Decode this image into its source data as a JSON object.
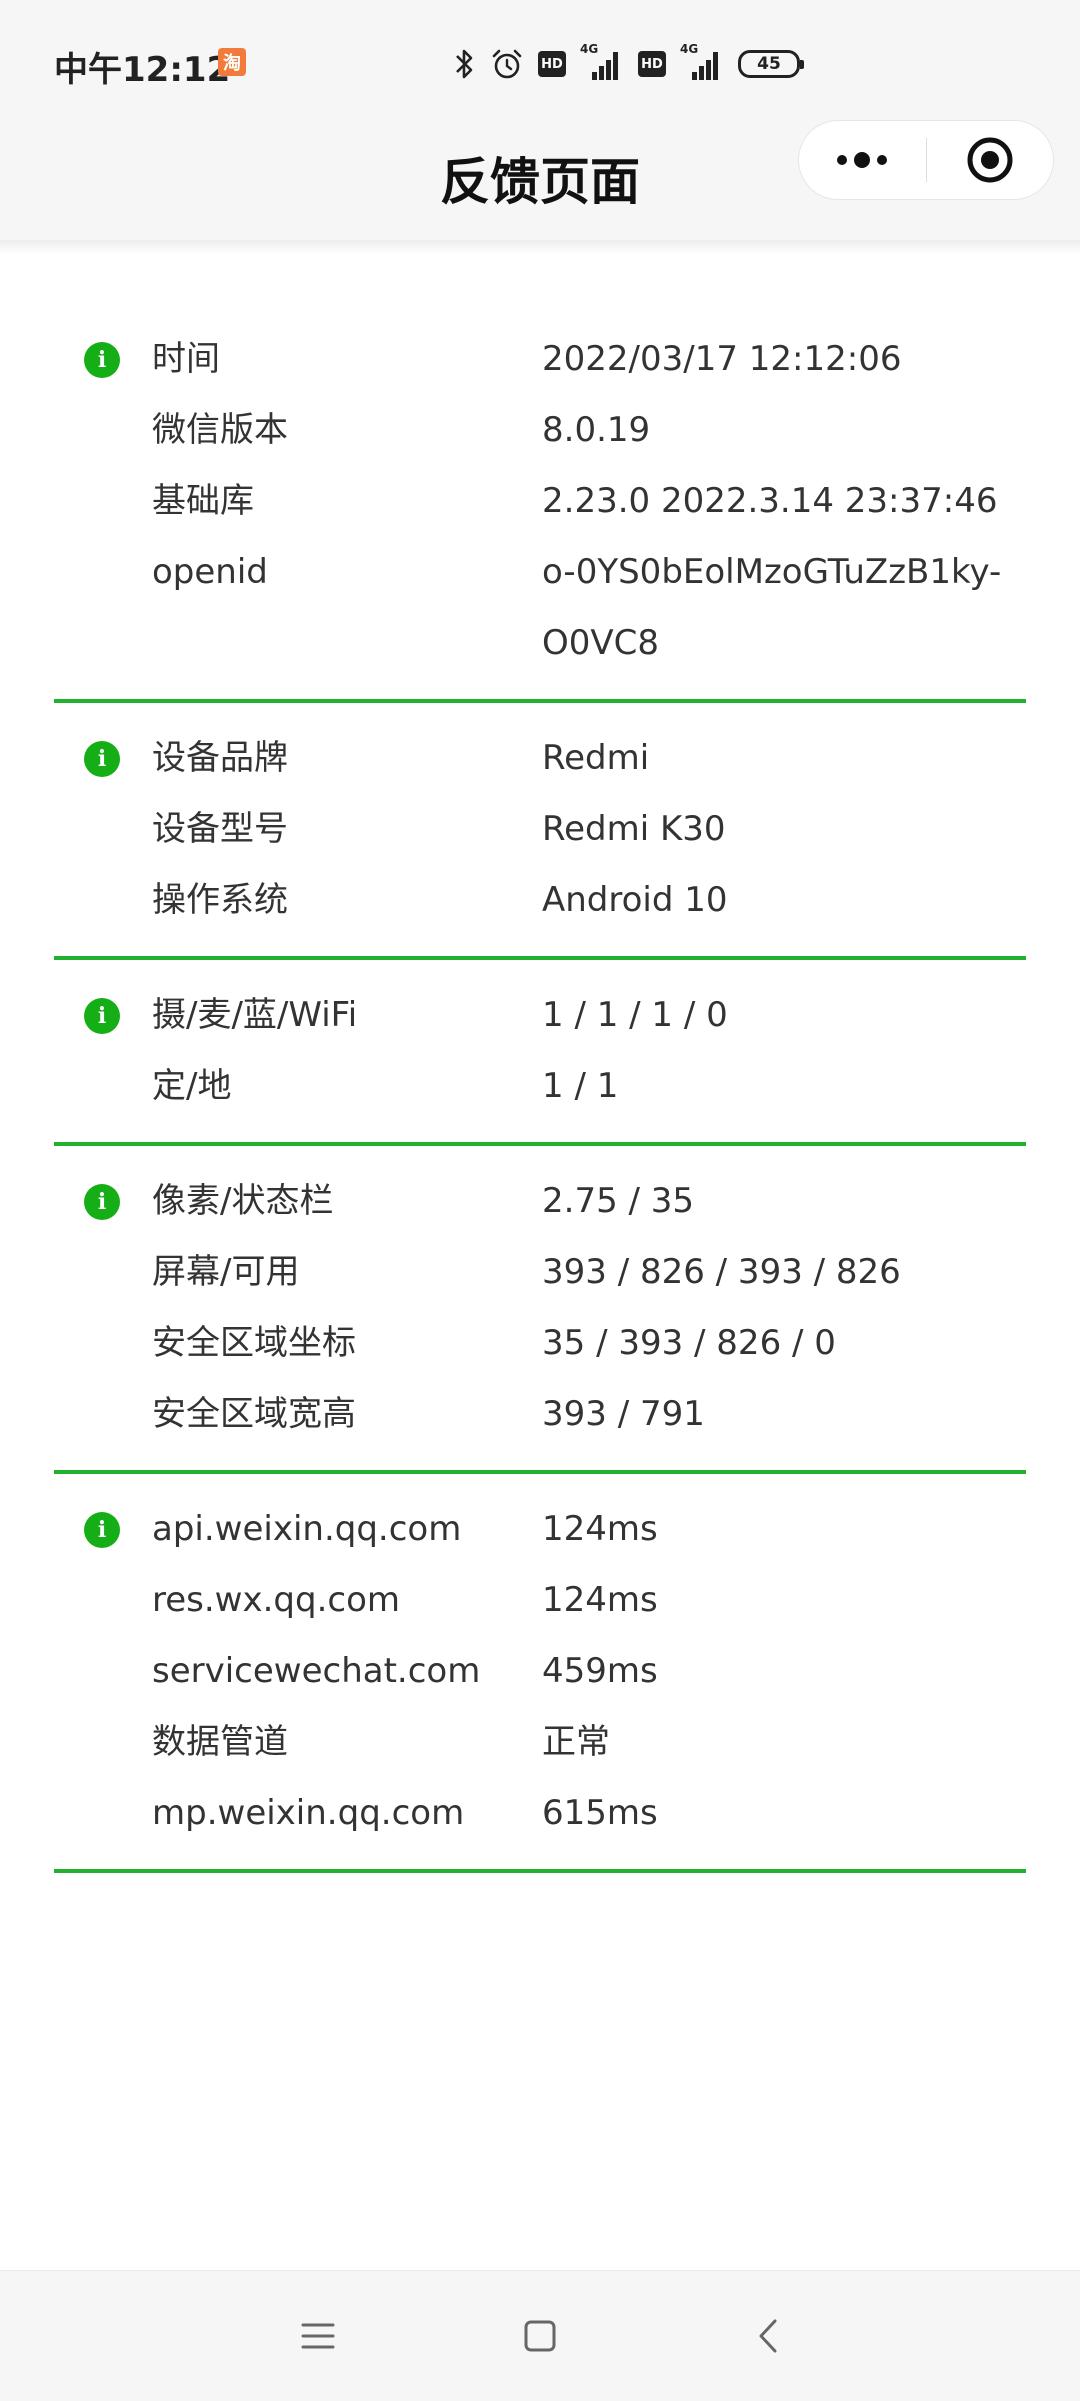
{
  "status_bar": {
    "time": "中午12:12",
    "app_badge": "淘",
    "hd_1": "HD",
    "hd_2": "HD",
    "net_1": "4G",
    "net_2": "4G",
    "battery": "45"
  },
  "nav": {
    "title": "反馈页面"
  },
  "sections": [
    {
      "rows": [
        {
          "label": "时间",
          "value": "2022/03/17 12:12:06"
        },
        {
          "label": "微信版本",
          "value": "8.0.19"
        },
        {
          "label": "基础库",
          "value": "2.23.0 2022.3.14 23:37:46"
        },
        {
          "label": "openid",
          "value": "o-0YS0bEolMzoGTuZzB1ky-O0VC8"
        }
      ]
    },
    {
      "rows": [
        {
          "label": "设备品牌",
          "value": "Redmi"
        },
        {
          "label": "设备型号",
          "value": "Redmi K30"
        },
        {
          "label": "操作系统",
          "value": "Android 10"
        }
      ]
    },
    {
      "rows": [
        {
          "label": "摄/麦/蓝/WiFi",
          "value": "1 / 1 / 1 / 0"
        },
        {
          "label": "定/地",
          "value": "1 / 1"
        }
      ]
    },
    {
      "rows": [
        {
          "label": "像素/状态栏",
          "value": "2.75 / 35"
        },
        {
          "label": "屏幕/可用",
          "value": "393 / 826 / 393 / 826"
        },
        {
          "label": "安全区域坐标",
          "value": "35 / 393 / 826 / 0"
        },
        {
          "label": "安全区域宽高",
          "value": "393 / 791"
        }
      ]
    },
    {
      "rows": [
        {
          "label": "api.weixin.qq.com",
          "value": "124ms"
        },
        {
          "label": "res.wx.qq.com",
          "value": "124ms"
        },
        {
          "label": "servicewechat.com",
          "value": "459ms"
        },
        {
          "label": "数据管道",
          "value": "正常"
        },
        {
          "label": "mp.weixin.qq.com",
          "value": "615ms"
        }
      ]
    }
  ],
  "info_icon_glyph": "i",
  "colors": {
    "accent": "#22b02f",
    "icon": "#16ae16"
  }
}
